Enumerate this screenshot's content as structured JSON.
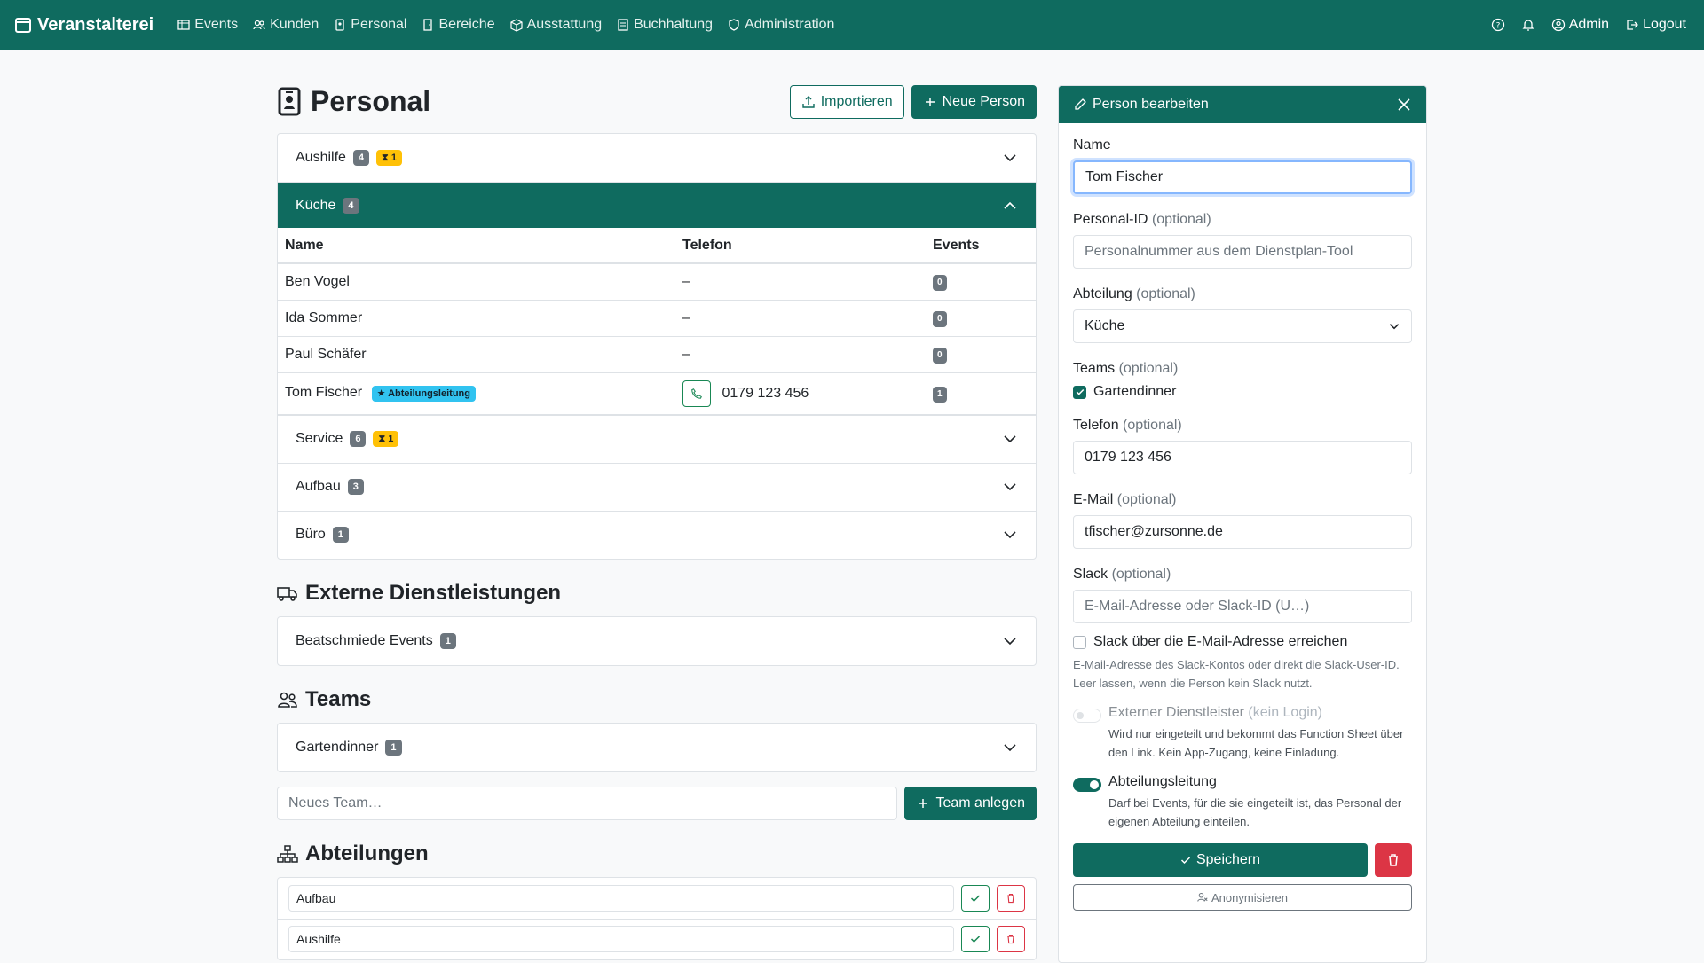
{
  "nav": {
    "brand": "Veranstalterei",
    "links": [
      "Events",
      "Kunden",
      "Personal",
      "Bereiche",
      "Ausstattung",
      "Buchhaltung",
      "Administration"
    ],
    "admin": "Admin",
    "logout": "Logout"
  },
  "page": {
    "title": "Personal",
    "import_label": "Importieren",
    "new_person_label": "Neue Person"
  },
  "groups": [
    {
      "name": "Aushilfe",
      "count": "4",
      "pending": "1"
    },
    {
      "name": "Küche",
      "count": "4"
    },
    {
      "name": "Service",
      "count": "6",
      "pending": "1"
    },
    {
      "name": "Aufbau",
      "count": "3"
    },
    {
      "name": "Büro",
      "count": "1"
    }
  ],
  "table": {
    "headers": [
      "Name",
      "Telefon",
      "Events"
    ],
    "rows": [
      {
        "name": "Ben Vogel",
        "phone": "–",
        "events": "0"
      },
      {
        "name": "Ida Sommer",
        "phone": "–",
        "events": "0"
      },
      {
        "name": "Paul Schäfer",
        "phone": "–",
        "events": "0"
      },
      {
        "name": "Tom Fischer",
        "badge": "Abteilungsleitung",
        "phone": "0179 123 456",
        "events": "1"
      }
    ]
  },
  "external": {
    "title": "Externe Dienstleistungen",
    "items": [
      {
        "name": "Beatschmiede Events",
        "count": "1"
      }
    ]
  },
  "teams": {
    "title": "Teams",
    "items": [
      {
        "name": "Gartendinner",
        "count": "1"
      }
    ],
    "new_placeholder": "Neues Team…",
    "create_label": "Team anlegen"
  },
  "departments": {
    "title": "Abteilungen",
    "items": [
      "Aufbau",
      "Aushilfe"
    ]
  },
  "editor": {
    "title": "Person bearbeiten",
    "name_label": "Name",
    "name_value": "Tom Fischer",
    "optional": "(optional)",
    "pid_label": "Personal-ID",
    "pid_placeholder": "Personalnummer aus dem Dienstplan-Tool",
    "dept_label": "Abteilung",
    "dept_value": "Küche",
    "teams_label": "Teams",
    "team_option": "Gartendinner",
    "phone_label": "Telefon",
    "phone_value": "0179 123 456",
    "email_label": "E-Mail",
    "email_value": "tfischer@zursonne.de",
    "slack_label": "Slack",
    "slack_placeholder": "E-Mail-Adresse oder Slack-ID (U…)",
    "slack_email_check": "Slack über die E-Mail-Adresse erreichen",
    "slack_help": "E-Mail-Adresse des Slack-Kontos oder direkt die Slack-User-ID. Leer lassen, wenn die Person kein Slack nutzt.",
    "external_label": "Externer Dienstleister",
    "external_sub": "(kein Login)",
    "external_help": "Wird nur eingeteilt und bekommt das Function Sheet über den Link. Kein App-Zugang, keine Einladung.",
    "lead_label": "Abteilungsleitung",
    "lead_help": "Darf bei Events, für die sie eingeteilt ist, das Personal der eigenen Abteilung einteilen.",
    "save_label": "Speichern",
    "anon_label": "Anonymisieren"
  },
  "colors": {
    "brand": "#0f6b5f",
    "danger": "#dc3545",
    "warning": "#ffc107",
    "info": "#31c3f0"
  }
}
